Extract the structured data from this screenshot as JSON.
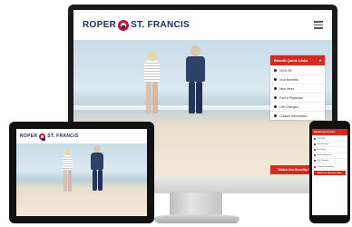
{
  "brand": {
    "name": "ROPER",
    "name_suffix": "ST. FRANCIS",
    "accent": "#d52b1e",
    "navy": "#1d2a57"
  },
  "quick_links": {
    "title": "Benefit Quick Links",
    "items": [
      {
        "label": "2018 VB",
        "icon": "chart-icon"
      },
      {
        "label": "Your Benefits",
        "icon": "star-icon"
      },
      {
        "label": "New Hires",
        "icon": "user-icon"
      },
      {
        "label": "Find a Physician",
        "icon": "stethoscope-icon"
      },
      {
        "label": "Life Changes",
        "icon": "heart-icon"
      },
      {
        "label": "Contact Information",
        "icon": "contact-icon"
      }
    ],
    "cta": "Watch Our Benefits Video"
  }
}
